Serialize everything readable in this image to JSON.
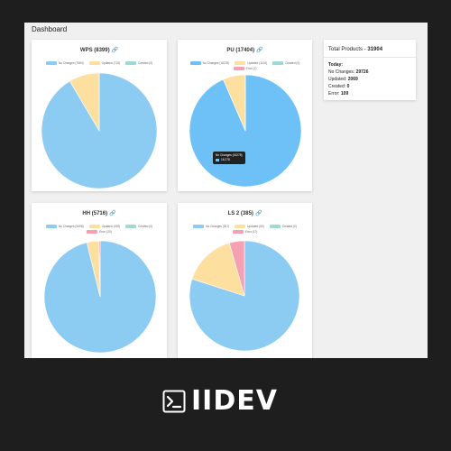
{
  "page": {
    "title": "Dashboard"
  },
  "colors": {
    "no_changes": "#8ccbf2",
    "updated": "#fde0a0",
    "created": "#9ed9d8",
    "error": "#f6a0b3",
    "background": "#1e1e1e"
  },
  "cards": [
    {
      "title": "WPS (8399)",
      "link_icon": "link-icon",
      "legend": [
        {
          "label": "No Changes (7684)",
          "color": "#8ccbf2"
        },
        {
          "label": "Updated (715)",
          "color": "#fde0a0"
        },
        {
          "label": "Created (0)",
          "color": "#9ed9d8"
        }
      ]
    },
    {
      "title": "PU (17404)",
      "link_icon": "link-icon",
      "legend": [
        {
          "label": "No Changes (16278)",
          "color": "#6ec1f7"
        },
        {
          "label": "Updated (1124)",
          "color": "#fde0a0"
        },
        {
          "label": "Created (0)",
          "color": "#9ed9d8"
        },
        {
          "label": "Error (2)",
          "color": "#f6a0b3"
        }
      ],
      "tooltip": {
        "title": "No Changes (16278)",
        "value": "16,278"
      }
    },
    {
      "title": "HH (5716)",
      "link_icon": "link-icon",
      "legend": [
        {
          "label": "No Changes (5498)",
          "color": "#8ccbf2"
        },
        {
          "label": "Updated (198)",
          "color": "#fde0a0"
        },
        {
          "label": "Created (0)",
          "color": "#9ed9d8"
        },
        {
          "label": "Error (20)",
          "color": "#f6a0b3"
        }
      ]
    },
    {
      "title": "LS 2 (385)",
      "link_icon": "link-icon",
      "legend": [
        {
          "label": "No Changes (307)",
          "color": "#8ccbf2"
        },
        {
          "label": "Updated (60)",
          "color": "#fde0a0"
        },
        {
          "label": "Created (0)",
          "color": "#9ed9d8"
        },
        {
          "label": "Error (17)",
          "color": "#f6a0b3"
        }
      ]
    }
  ],
  "chart_data": [
    {
      "type": "pie",
      "title": "WPS (8399)",
      "categories": [
        "No Changes",
        "Updated",
        "Created"
      ],
      "values": [
        7684,
        715,
        0
      ],
      "colors": [
        "#8ccbf2",
        "#fde0a0",
        "#9ed9d8"
      ]
    },
    {
      "type": "pie",
      "title": "PU (17404)",
      "categories": [
        "No Changes",
        "Updated",
        "Created",
        "Error"
      ],
      "values": [
        16278,
        1124,
        0,
        2
      ],
      "colors": [
        "#6ec1f7",
        "#fde0a0",
        "#9ed9d8",
        "#f6a0b3"
      ]
    },
    {
      "type": "pie",
      "title": "HH (5716)",
      "categories": [
        "No Changes",
        "Updated",
        "Created",
        "Error"
      ],
      "values": [
        5498,
        198,
        0,
        20
      ],
      "colors": [
        "#8ccbf2",
        "#fde0a0",
        "#9ed9d8",
        "#f6a0b3"
      ]
    },
    {
      "type": "pie",
      "title": "LS 2 (385)",
      "categories": [
        "No Changes",
        "Updated",
        "Created",
        "Error"
      ],
      "values": [
        307,
        60,
        0,
        17
      ],
      "colors": [
        "#8ccbf2",
        "#fde0a0",
        "#9ed9d8",
        "#f6a0b3"
      ]
    }
  ],
  "totals": {
    "title_label": "Total Products - ",
    "title_value": "31904",
    "today_label": "Today:",
    "rows": [
      {
        "label": "No Changes: ",
        "value": "29726"
      },
      {
        "label": "Updated: ",
        "value": "2069"
      },
      {
        "label": "Created: ",
        "value": "0"
      },
      {
        "label": "Error: ",
        "value": "109"
      }
    ]
  },
  "brand": {
    "name": "IIDEV",
    "icon": "terminal-icon"
  }
}
